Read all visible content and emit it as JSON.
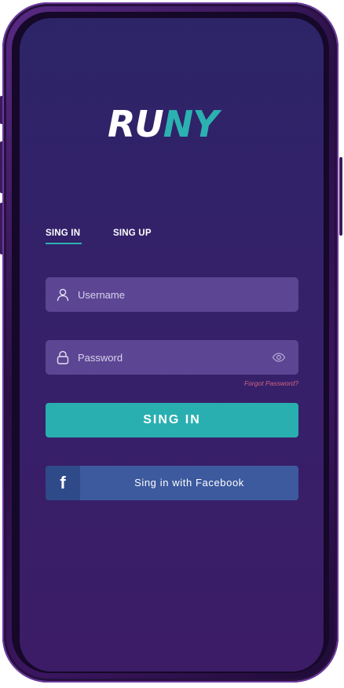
{
  "logo": {
    "part1": "RU",
    "part2": "NY",
    "accent_color": "#2cb1b1"
  },
  "tabs": [
    {
      "label": "SING IN",
      "active": true
    },
    {
      "label": "SING UP",
      "active": false
    }
  ],
  "form": {
    "username": {
      "placeholder": "Username",
      "value": "",
      "icon": "user-icon"
    },
    "password": {
      "placeholder": "Password",
      "value": "",
      "icon": "lock-icon",
      "toggle_icon": "eye-icon"
    },
    "forgot_label": "Forgot Password?",
    "submit_label": "SING IN"
  },
  "facebook": {
    "icon_glyph": "f",
    "label": "Sing in with Facebook",
    "color": "#3d5a9e"
  },
  "colors": {
    "background": "#2d2468",
    "field": "#5c4693",
    "primary_button": "#2aafb1",
    "forgot_link": "#d0657f"
  }
}
